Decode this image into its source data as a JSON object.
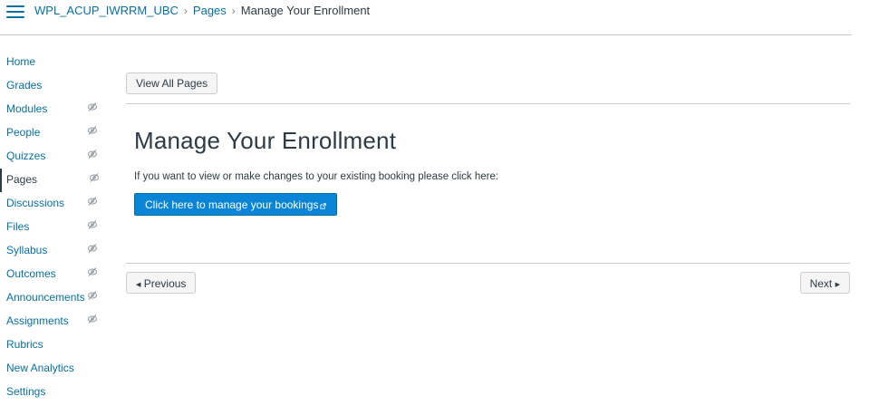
{
  "breadcrumb": {
    "course": "WPL_ACUP_IWRRM_UBC",
    "section": "Pages",
    "current": "Manage Your Enrollment"
  },
  "nav": {
    "items": [
      {
        "label": "Home",
        "hidden_icon": false,
        "active": false
      },
      {
        "label": "Grades",
        "hidden_icon": false,
        "active": false
      },
      {
        "label": "Modules",
        "hidden_icon": true,
        "active": false
      },
      {
        "label": "People",
        "hidden_icon": true,
        "active": false
      },
      {
        "label": "Quizzes",
        "hidden_icon": true,
        "active": false
      },
      {
        "label": "Pages",
        "hidden_icon": true,
        "active": true
      },
      {
        "label": "Discussions",
        "hidden_icon": true,
        "active": false
      },
      {
        "label": "Files",
        "hidden_icon": true,
        "active": false
      },
      {
        "label": "Syllabus",
        "hidden_icon": true,
        "active": false
      },
      {
        "label": "Outcomes",
        "hidden_icon": true,
        "active": false
      },
      {
        "label": "Announcements",
        "hidden_icon": true,
        "active": false
      },
      {
        "label": "Assignments",
        "hidden_icon": true,
        "active": false
      },
      {
        "label": "Rubrics",
        "hidden_icon": false,
        "active": false
      },
      {
        "label": "New Analytics",
        "hidden_icon": false,
        "active": false
      },
      {
        "label": "Settings",
        "hidden_icon": false,
        "active": false
      }
    ]
  },
  "toolbar": {
    "view_all_label": "View All Pages"
  },
  "page": {
    "title": "Manage Your Enrollment",
    "description": "If you want to view or make changes to your existing booking please click here:",
    "manage_button_label": "Click here to manage your bookings"
  },
  "pagination": {
    "previous_label": "Previous",
    "next_label": "Next"
  },
  "colors": {
    "link": "#0770a3",
    "primary_button": "#0a84d6",
    "text": "#2d3b45",
    "border": "#c7cdd1"
  }
}
